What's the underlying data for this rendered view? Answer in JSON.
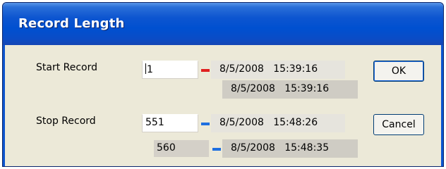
{
  "window": {
    "title": "Record Length"
  },
  "start": {
    "label": "Start Record",
    "value": "1",
    "time_start": "8/5/2008   15:39:16",
    "time_end": "8/5/2008   15:39:16",
    "dash_color": "#e02020"
  },
  "stop": {
    "label": "Stop Record",
    "value": "551",
    "max_value": "560",
    "time_start": "8/5/2008   15:48:26",
    "time_end": "8/5/2008   15:48:35",
    "dash_color": "#1e6fe0"
  },
  "buttons": {
    "ok": "OK",
    "cancel": "Cancel"
  }
}
